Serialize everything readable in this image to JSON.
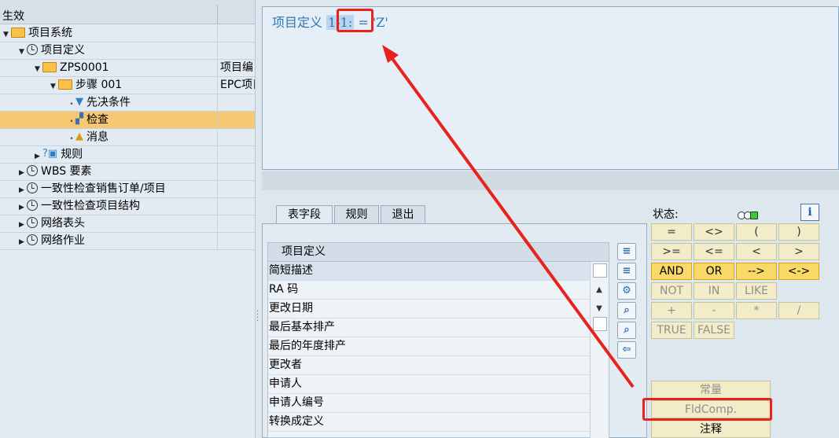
{
  "tree": {
    "header": {
      "col1": "生效"
    },
    "rows": [
      {
        "label": "项目系统",
        "col2": ""
      },
      {
        "label": "项目定义",
        "col2": ""
      },
      {
        "label": "ZPS0001",
        "col2": "项目编"
      },
      {
        "label": "步骤 001",
        "col2": "EPC项目"
      },
      {
        "label": "先决条件",
        "col2": ""
      },
      {
        "label": "检查",
        "col2": ""
      },
      {
        "label": "消息",
        "col2": ""
      },
      {
        "label": "规则",
        "col2": ""
      },
      {
        "label": "WBS 要素",
        "col2": ""
      },
      {
        "label": "一致性检查销售订单/项目",
        "col2": ""
      },
      {
        "label": "一致性检查项目结构",
        "col2": ""
      },
      {
        "label": "网络表头",
        "col2": ""
      },
      {
        "label": "网络作业",
        "col2": ""
      }
    ]
  },
  "editor": {
    "prefix": "项目定义 ",
    "highlight": "1-1:",
    "suffix": " = 'Z'"
  },
  "tabs": [
    "表字段",
    "规则",
    "退出"
  ],
  "fieldlist": {
    "header": "项目定义",
    "rows": [
      "简短描述",
      "RA 码",
      "更改日期",
      "最后基本排产",
      "最后的年度排产",
      "更改者",
      "申请人",
      "申请人编号",
      "转换成定义"
    ]
  },
  "status": {
    "label": "状态:"
  },
  "operators": {
    "row1": [
      "=",
      "<>",
      "(",
      ")"
    ],
    "row2": [
      ">=",
      "<=",
      "<",
      ">"
    ],
    "row3": [
      "AND",
      "OR",
      "-->",
      "<->"
    ],
    "row4": [
      "NOT",
      "IN",
      "LIKE"
    ],
    "row5": [
      "+",
      "-",
      "*",
      "/"
    ],
    "row6": [
      "TRUE",
      "FALSE"
    ]
  },
  "actions": {
    "constant": "常量",
    "fldcomp": "FldComp.",
    "comment": "注释"
  },
  "colors": {
    "highlight_box": "#e8221c",
    "selection": "#f6c871"
  }
}
